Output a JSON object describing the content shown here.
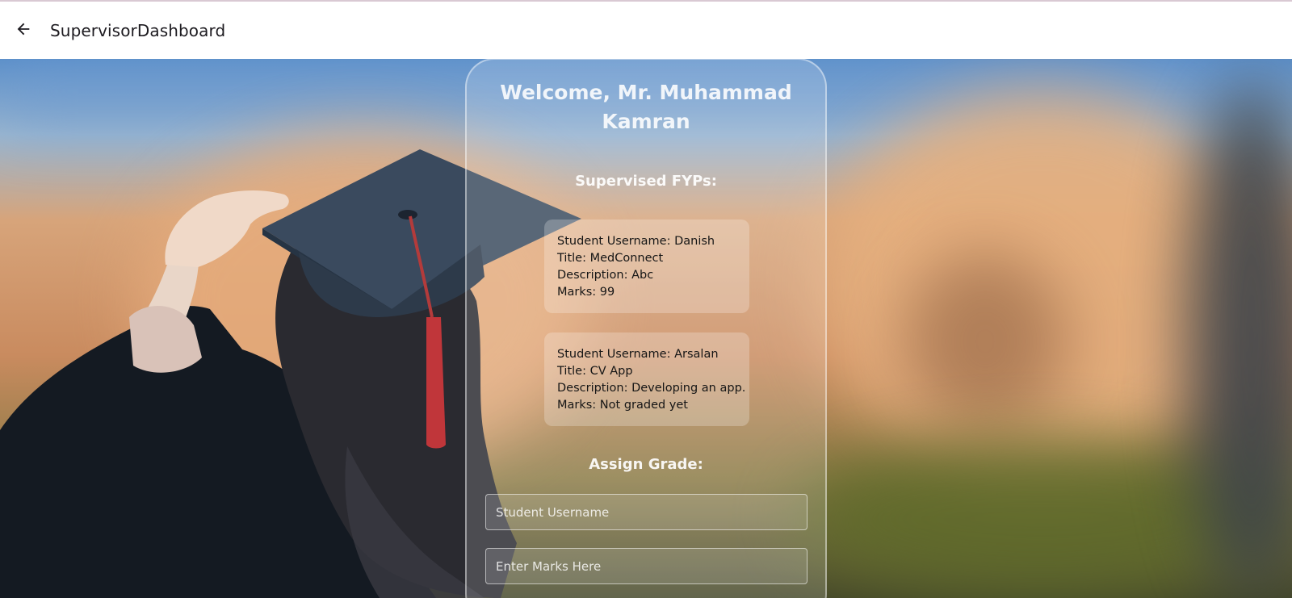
{
  "appbar": {
    "back_icon": "arrow-left-icon",
    "title": "SupervisorDashboard"
  },
  "welcome": {
    "line1": "Welcome, Mr. Muhammad",
    "line2": "Kamran"
  },
  "supervised_heading": "Supervised FYPs:",
  "fyps": [
    {
      "username": "Student Username: Danish",
      "title": "Title: MedConnect",
      "description": "Description: Abc",
      "marks": "Marks: 99"
    },
    {
      "username": "Student Username: Arsalan",
      "title": "Title: CV App",
      "description": "Description: Developing an app.",
      "marks": "Marks: Not graded yet"
    }
  ],
  "assign_heading": "Assign Grade:",
  "form": {
    "username_placeholder": "Student Username",
    "marks_placeholder": "Enter Marks Here"
  },
  "colors": {
    "appbar_bg": "#ffffff",
    "title_text": "#1d1b20",
    "panel_border": "rgba(255,255,255,0.45)"
  }
}
